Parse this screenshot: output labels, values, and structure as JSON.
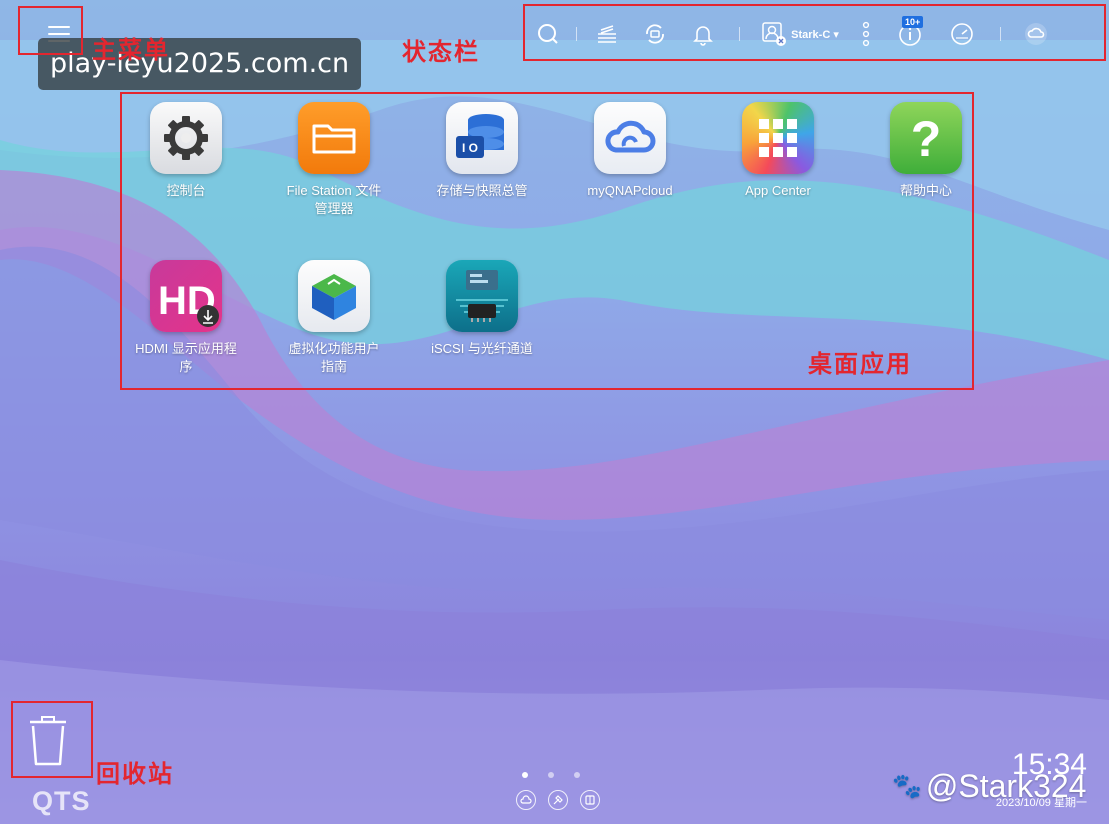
{
  "annotations": {
    "main_menu": "主菜单",
    "status_bar": "状态栏",
    "desktop_apps": "桌面应用",
    "recycle_bin": "回收站"
  },
  "watermark": {
    "url": "play-leyu2025.com.cn"
  },
  "statusbar": {
    "items": [
      {
        "icon": "search-icon"
      },
      {
        "icon": "tasks-icon"
      },
      {
        "icon": "sync-icon"
      },
      {
        "icon": "bell-icon"
      },
      {
        "icon": "user-icon"
      },
      {
        "icon": "more-vertical-icon"
      },
      {
        "icon": "info-icon"
      },
      {
        "icon": "gauge-icon"
      },
      {
        "icon": "cloud-icon"
      }
    ],
    "user_name": "Stark-C ▾",
    "info_badge": "10+"
  },
  "apps": [
    {
      "label": "控制台",
      "icon": "gear-icon"
    },
    {
      "label": "File Station 文件\n管理器",
      "icon": "folder-icon"
    },
    {
      "label": "存储与快照总管",
      "icon": "database-icon"
    },
    {
      "label": "myQNAPcloud",
      "icon": "cloud-icon"
    },
    {
      "label": "App Center",
      "icon": "app-grid-icon"
    },
    {
      "label": "帮助中心",
      "icon": "question-icon"
    },
    {
      "label": "HDMI 显示应用程\n序",
      "icon": "hd-icon"
    },
    {
      "label": "虚拟化功能用户\n指南",
      "icon": "cube-icon"
    },
    {
      "label": "iSCSI 与光纤通道",
      "icon": "server-icon"
    }
  ],
  "logo": "QTS",
  "clock": {
    "time": "15:34",
    "date": "2023/10/09 星期一"
  },
  "social": {
    "handle": "@Stark324"
  },
  "colors": {
    "annotation": "#e3262f",
    "badge": "#1f6fe0"
  }
}
